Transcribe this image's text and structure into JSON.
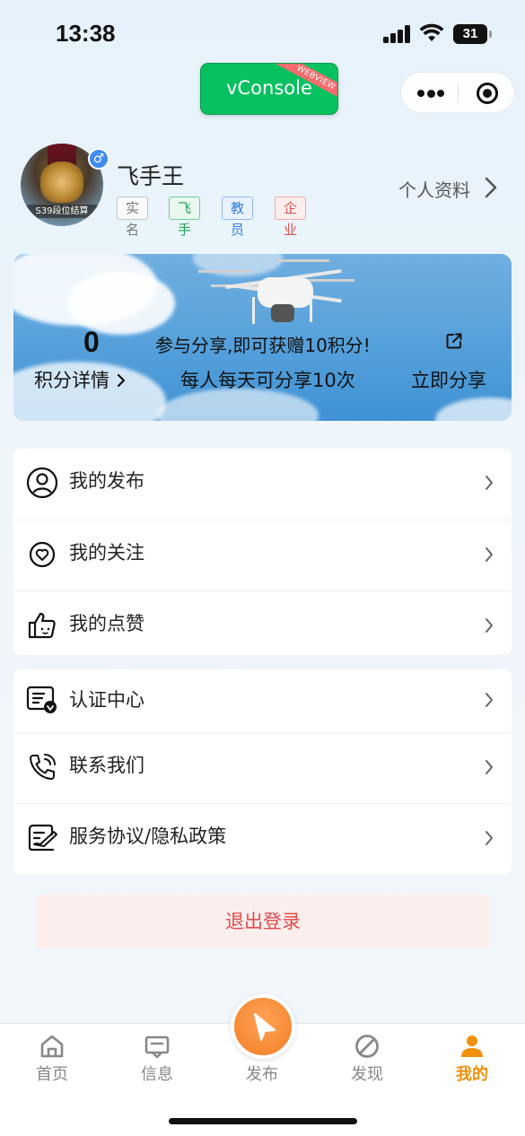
{
  "status_bar": {
    "time": "13:38",
    "battery": "31"
  },
  "vconsole": {
    "label": "vConsole",
    "ribbon": "WEBVIEW"
  },
  "profile": {
    "avatar_rank": "S39段位结算",
    "gender": "♂",
    "name": "飞手王",
    "tags": [
      "实名",
      "飞手",
      "教员",
      "企业"
    ],
    "profile_link": "个人资料"
  },
  "share_banner": {
    "points": "0",
    "points_detail": "积分详情",
    "promo": "参与分享,即可获赠10积分!",
    "limit": "每人每天可分享10次",
    "share_now": "立即分享"
  },
  "menu_group_1": [
    {
      "label": "我的发布",
      "icon": "user-circle-icon"
    },
    {
      "label": "我的关注",
      "icon": "heart-circle-icon"
    },
    {
      "label": "我的点赞",
      "icon": "thumbs-up-icon"
    }
  ],
  "menu_group_2": [
    {
      "label": "认证中心",
      "icon": "certificate-icon"
    },
    {
      "label": "联系我们",
      "icon": "phone-icon"
    },
    {
      "label": "服务协议/隐私政策",
      "icon": "agreement-icon"
    }
  ],
  "logout": "退出登录",
  "tabbar": {
    "items": [
      {
        "label": "首页",
        "icon": "home-icon"
      },
      {
        "label": "信息",
        "icon": "message-icon"
      },
      {
        "label": "发布",
        "icon": "publish-icon"
      },
      {
        "label": "发现",
        "icon": "compass-icon"
      },
      {
        "label": "我的",
        "icon": "person-icon"
      }
    ],
    "active_index": 4
  },
  "colors": {
    "accent": "#f0900c",
    "danger": "#e24a4a",
    "vconsole": "#07c160"
  }
}
